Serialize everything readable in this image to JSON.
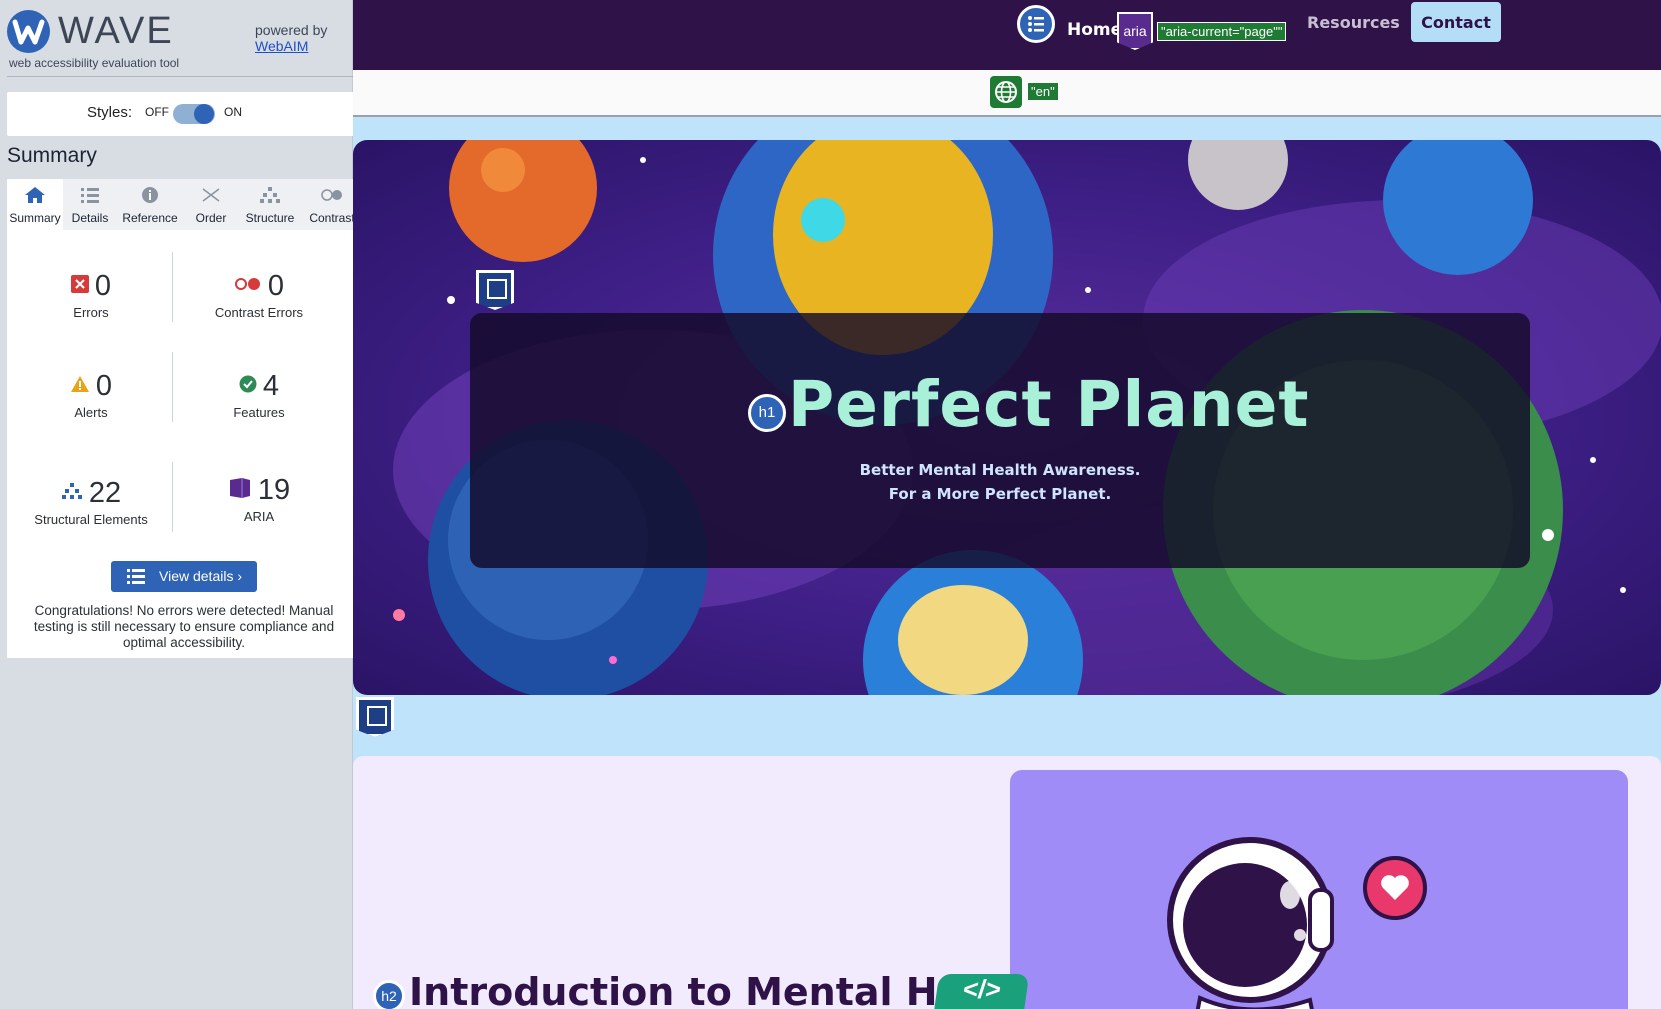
{
  "wave": {
    "brand": "WAVE",
    "tagline": "web accessibility evaluation tool",
    "powered_by": "powered by",
    "webaim_link": "WebAIM",
    "styles_label": "Styles:",
    "styles_off": "OFF",
    "styles_on": "ON",
    "styles_enabled": true,
    "summary_title": "Summary",
    "tabs": [
      {
        "label": "Summary",
        "icon": "home-icon",
        "active": true
      },
      {
        "label": "Details",
        "icon": "list-icon",
        "active": false
      },
      {
        "label": "Reference",
        "icon": "info-icon",
        "active": false
      },
      {
        "label": "Order",
        "icon": "order-icon",
        "active": false
      },
      {
        "label": "Structure",
        "icon": "structure-icon",
        "active": false
      },
      {
        "label": "Contrast",
        "icon": "contrast-icon",
        "active": false
      }
    ],
    "stats": {
      "errors": {
        "value": "0",
        "label": "Errors"
      },
      "contrast_errors": {
        "value": "0",
        "label": "Contrast Errors"
      },
      "alerts": {
        "value": "0",
        "label": "Alerts"
      },
      "features": {
        "value": "4",
        "label": "Features"
      },
      "structural": {
        "value": "22",
        "label": "Structural Elements"
      },
      "aria": {
        "value": "19",
        "label": "ARIA"
      }
    },
    "view_details": "View details ›",
    "congrats": "Congratulations! No errors were detected! Manual testing is still necessary to ensure compliance and optimal accessibility.",
    "colors": {
      "primary": "#2f63b6",
      "error": "#d63a3a",
      "alert": "#e8a317",
      "feature": "#2e8b57",
      "aria": "#5a2b8e"
    }
  },
  "site": {
    "nav": {
      "home": "Home",
      "aria_badge": "aria",
      "aria_current": "\"aria-current=\"page\"\"",
      "resources": "Resources",
      "contact": "Contact"
    },
    "lang_badge": "\"en\"",
    "hero": {
      "h1_badge": "h1",
      "title": "Perfect Planet",
      "subtitle_line1": "Better Mental Health Awareness.",
      "subtitle_line2": "For a More Perfect Planet."
    },
    "intro": {
      "h2_badge": "h2",
      "title": "Introduction to Mental Healt",
      "code_badge": "</>"
    },
    "colors": {
      "nav_bg": "#2f1248",
      "hero_title": "#a8f0d8",
      "page_bg": "#bfe3fa",
      "content_bg": "#f2ebfd",
      "astro_bg": "#9f8cf7"
    }
  }
}
